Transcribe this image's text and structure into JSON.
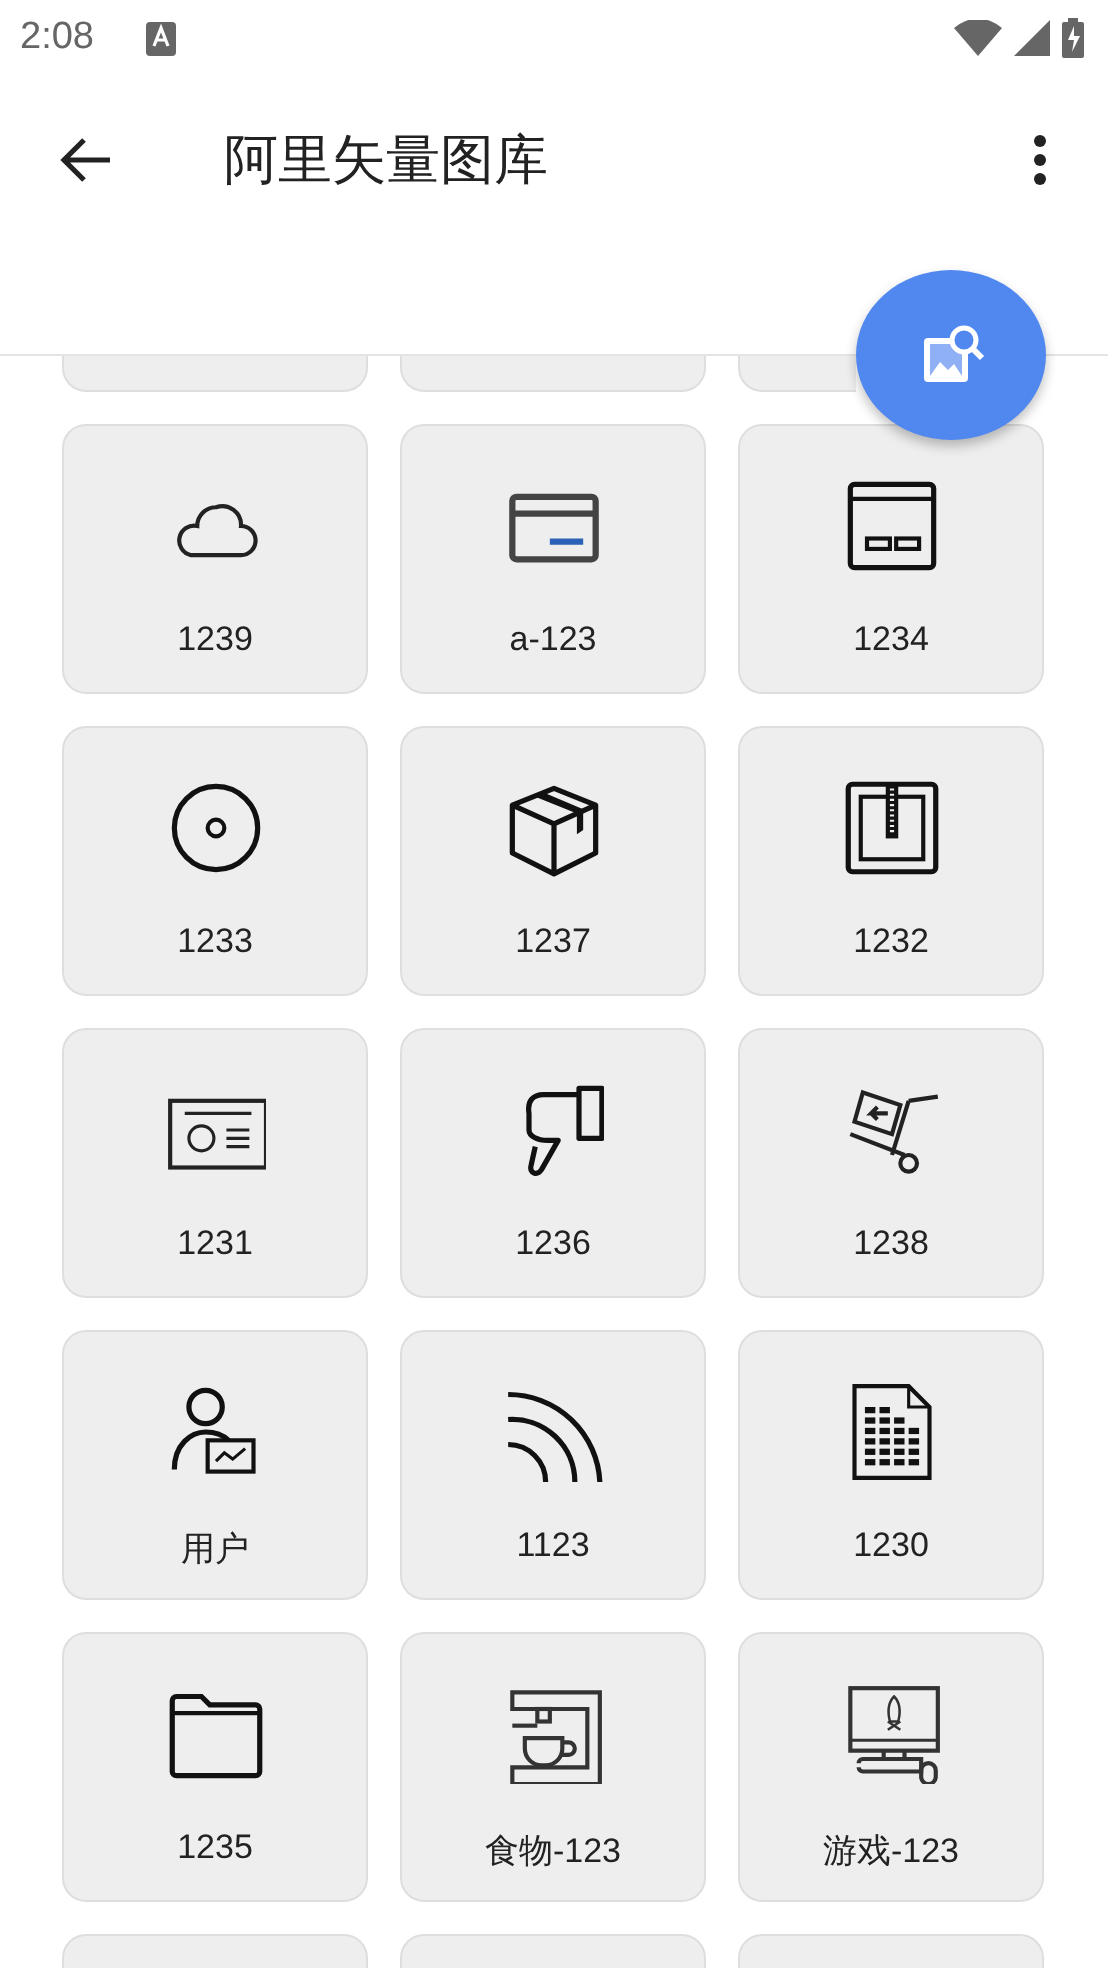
{
  "status_bar": {
    "time": "2:08"
  },
  "toolbar": {
    "title": "阿里矢量图库"
  },
  "tiles": [
    {
      "kind": "clipped"
    },
    {
      "kind": "clipped"
    },
    {
      "kind": "clipped"
    },
    {
      "kind": "icon",
      "label": "1239"
    },
    {
      "kind": "icon",
      "label": "a-123"
    },
    {
      "kind": "icon",
      "label": "1234"
    },
    {
      "kind": "icon",
      "label": "1233"
    },
    {
      "kind": "icon",
      "label": "1237"
    },
    {
      "kind": "icon",
      "label": "1232"
    },
    {
      "kind": "icon",
      "label": "1231"
    },
    {
      "kind": "icon",
      "label": "1236"
    },
    {
      "kind": "icon",
      "label": "1238"
    },
    {
      "kind": "icon",
      "label": "用户"
    },
    {
      "kind": "icon",
      "label": "1123"
    },
    {
      "kind": "icon",
      "label": "1230"
    },
    {
      "kind": "icon",
      "label": "1235"
    },
    {
      "kind": "icon",
      "label": "食物-123"
    },
    {
      "kind": "icon",
      "label": "游戏-123"
    },
    {
      "kind": "clipped"
    },
    {
      "kind": "clipped"
    },
    {
      "kind": "clipped"
    }
  ]
}
